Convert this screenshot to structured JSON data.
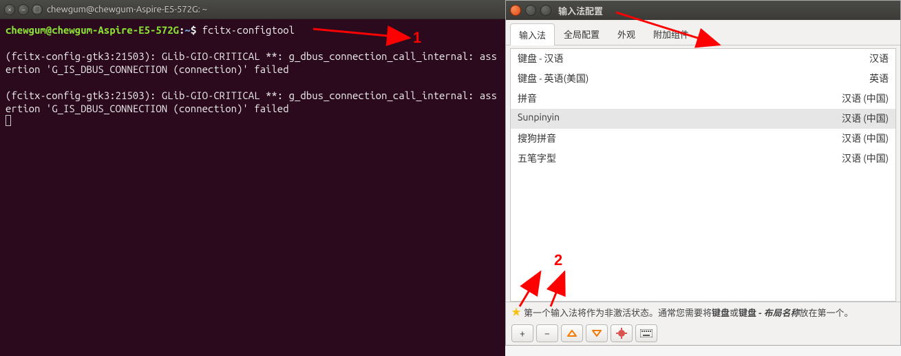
{
  "terminal": {
    "title": "chewgum@chewgum-Aspire-E5-572G: ~",
    "prompt_user": "chewgum@chewgum-Aspire-E5-572G",
    "prompt_path": "~",
    "prompt_symbol": "$",
    "command": "fcitx-configtool",
    "output_lines": [
      "",
      "(fcitx-config-gtk3:21503): GLib-GIO-CRITICAL **: g_dbus_connection_call_internal: assertion 'G_IS_DBUS_CONNECTION (connection)' failed",
      "",
      "(fcitx-config-gtk3:21503): GLib-GIO-CRITICAL **: g_dbus_connection_call_internal: assertion 'G_IS_DBUS_CONNECTION (connection)' failed"
    ]
  },
  "config": {
    "title": "输入法配置",
    "tabs": [
      {
        "label": "输入法",
        "active": true
      },
      {
        "label": "全局配置",
        "active": false
      },
      {
        "label": "外观",
        "active": false
      },
      {
        "label": "附加组件",
        "active": false
      }
    ],
    "ims": [
      {
        "name": "键盘 - 汉语",
        "lang": "汉语",
        "selected": false
      },
      {
        "name": "键盘 - 英语(美国)",
        "lang": "英语",
        "selected": false
      },
      {
        "name": "拼音",
        "lang": "汉语 (中国)",
        "selected": false
      },
      {
        "name": "Sunpinyin",
        "lang": "汉语 (中国)",
        "selected": true
      },
      {
        "name": "搜狗拼音",
        "lang": "汉语 (中国)",
        "selected": false
      },
      {
        "name": "五笔字型",
        "lang": "汉语 (中国)",
        "selected": false
      }
    ],
    "hint_pre": "第一个输入法将作为非激活状态。通常您需要将",
    "hint_bold1": "键盘",
    "hint_or": "或",
    "hint_bold2": "键盘 - ",
    "hint_italic": "布局名称",
    "hint_post": "放在第一个。",
    "buttons": {
      "add": "+",
      "remove": "−",
      "up": "︿",
      "down": "﹀"
    }
  },
  "annotations": {
    "label1": "1",
    "label2": "2"
  }
}
